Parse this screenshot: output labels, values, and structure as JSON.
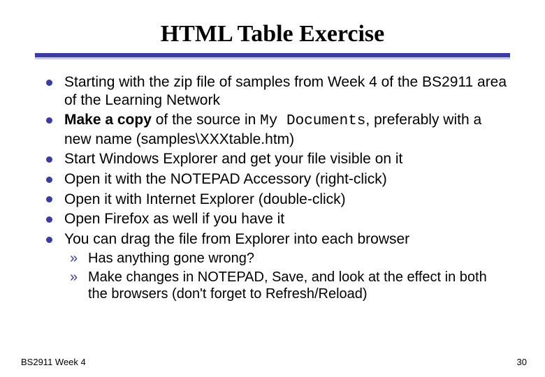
{
  "title": "HTML Table Exercise",
  "bullets": [
    {
      "html": "Starting with the zip file of samples from Week 4 of the BS2911 area of the Learning Network"
    },
    {
      "html": "<span class=\"bold\">Make a copy</span> of the source in <span class=\"mono\">My Documents</span>, preferably with a new name (samples\\XXXtable.htm)"
    },
    {
      "html": "Start Windows Explorer and get your file visible on it"
    },
    {
      "html": "Open it with the NOTEPAD Accessory (right-click)"
    },
    {
      "html": "Open it with Internet Explorer (double-click)"
    },
    {
      "html": "Open Firefox as well if you have it"
    },
    {
      "html": "You can drag the file from Explorer into each browser"
    }
  ],
  "sub_bullets": [
    {
      "html": "Has anything gone wrong?"
    },
    {
      "html": "Make changes in NOTEPAD, Save, and look at the effect in both the browsers (don't forget to Refresh/Reload)"
    }
  ],
  "footer_left": "BS2911 Week 4",
  "footer_right": "30"
}
